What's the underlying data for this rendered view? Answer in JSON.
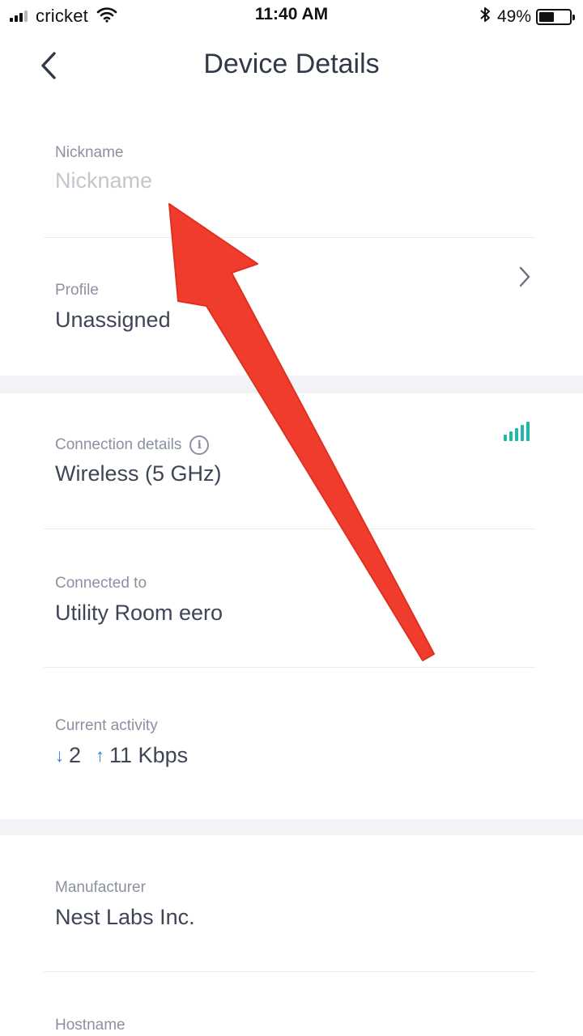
{
  "status_bar": {
    "carrier": "cricket",
    "time": "11:40 AM",
    "battery_percent": "49%",
    "battery_level": 0.49,
    "icons": [
      "cellular-signal-icon",
      "wifi-icon",
      "bluetooth-icon",
      "battery-icon"
    ]
  },
  "header": {
    "title": "Device Details",
    "back_icon": "chevron-left-icon"
  },
  "fields": {
    "nickname": {
      "label": "Nickname",
      "value": "",
      "placeholder": "Nickname"
    },
    "profile": {
      "label": "Profile",
      "value": "Unassigned"
    },
    "connection": {
      "label": "Connection details",
      "value": "Wireless (5 GHz)",
      "signal_color": "#21b8a8"
    },
    "connected_to": {
      "label": "Connected to",
      "value": "Utility Room eero"
    },
    "activity": {
      "label": "Current activity",
      "down_arrow": "↓",
      "down": "2",
      "up_arrow": "↑",
      "up": "11 Kbps"
    },
    "manufacturer": {
      "label": "Manufacturer",
      "value": "Nest Labs Inc."
    },
    "hostname": {
      "label": "Hostname"
    }
  },
  "colors": {
    "annotation_arrow": "#f03c2c",
    "accent_arrow": "#2c7fd6",
    "section_band": "#f2f3f6"
  }
}
